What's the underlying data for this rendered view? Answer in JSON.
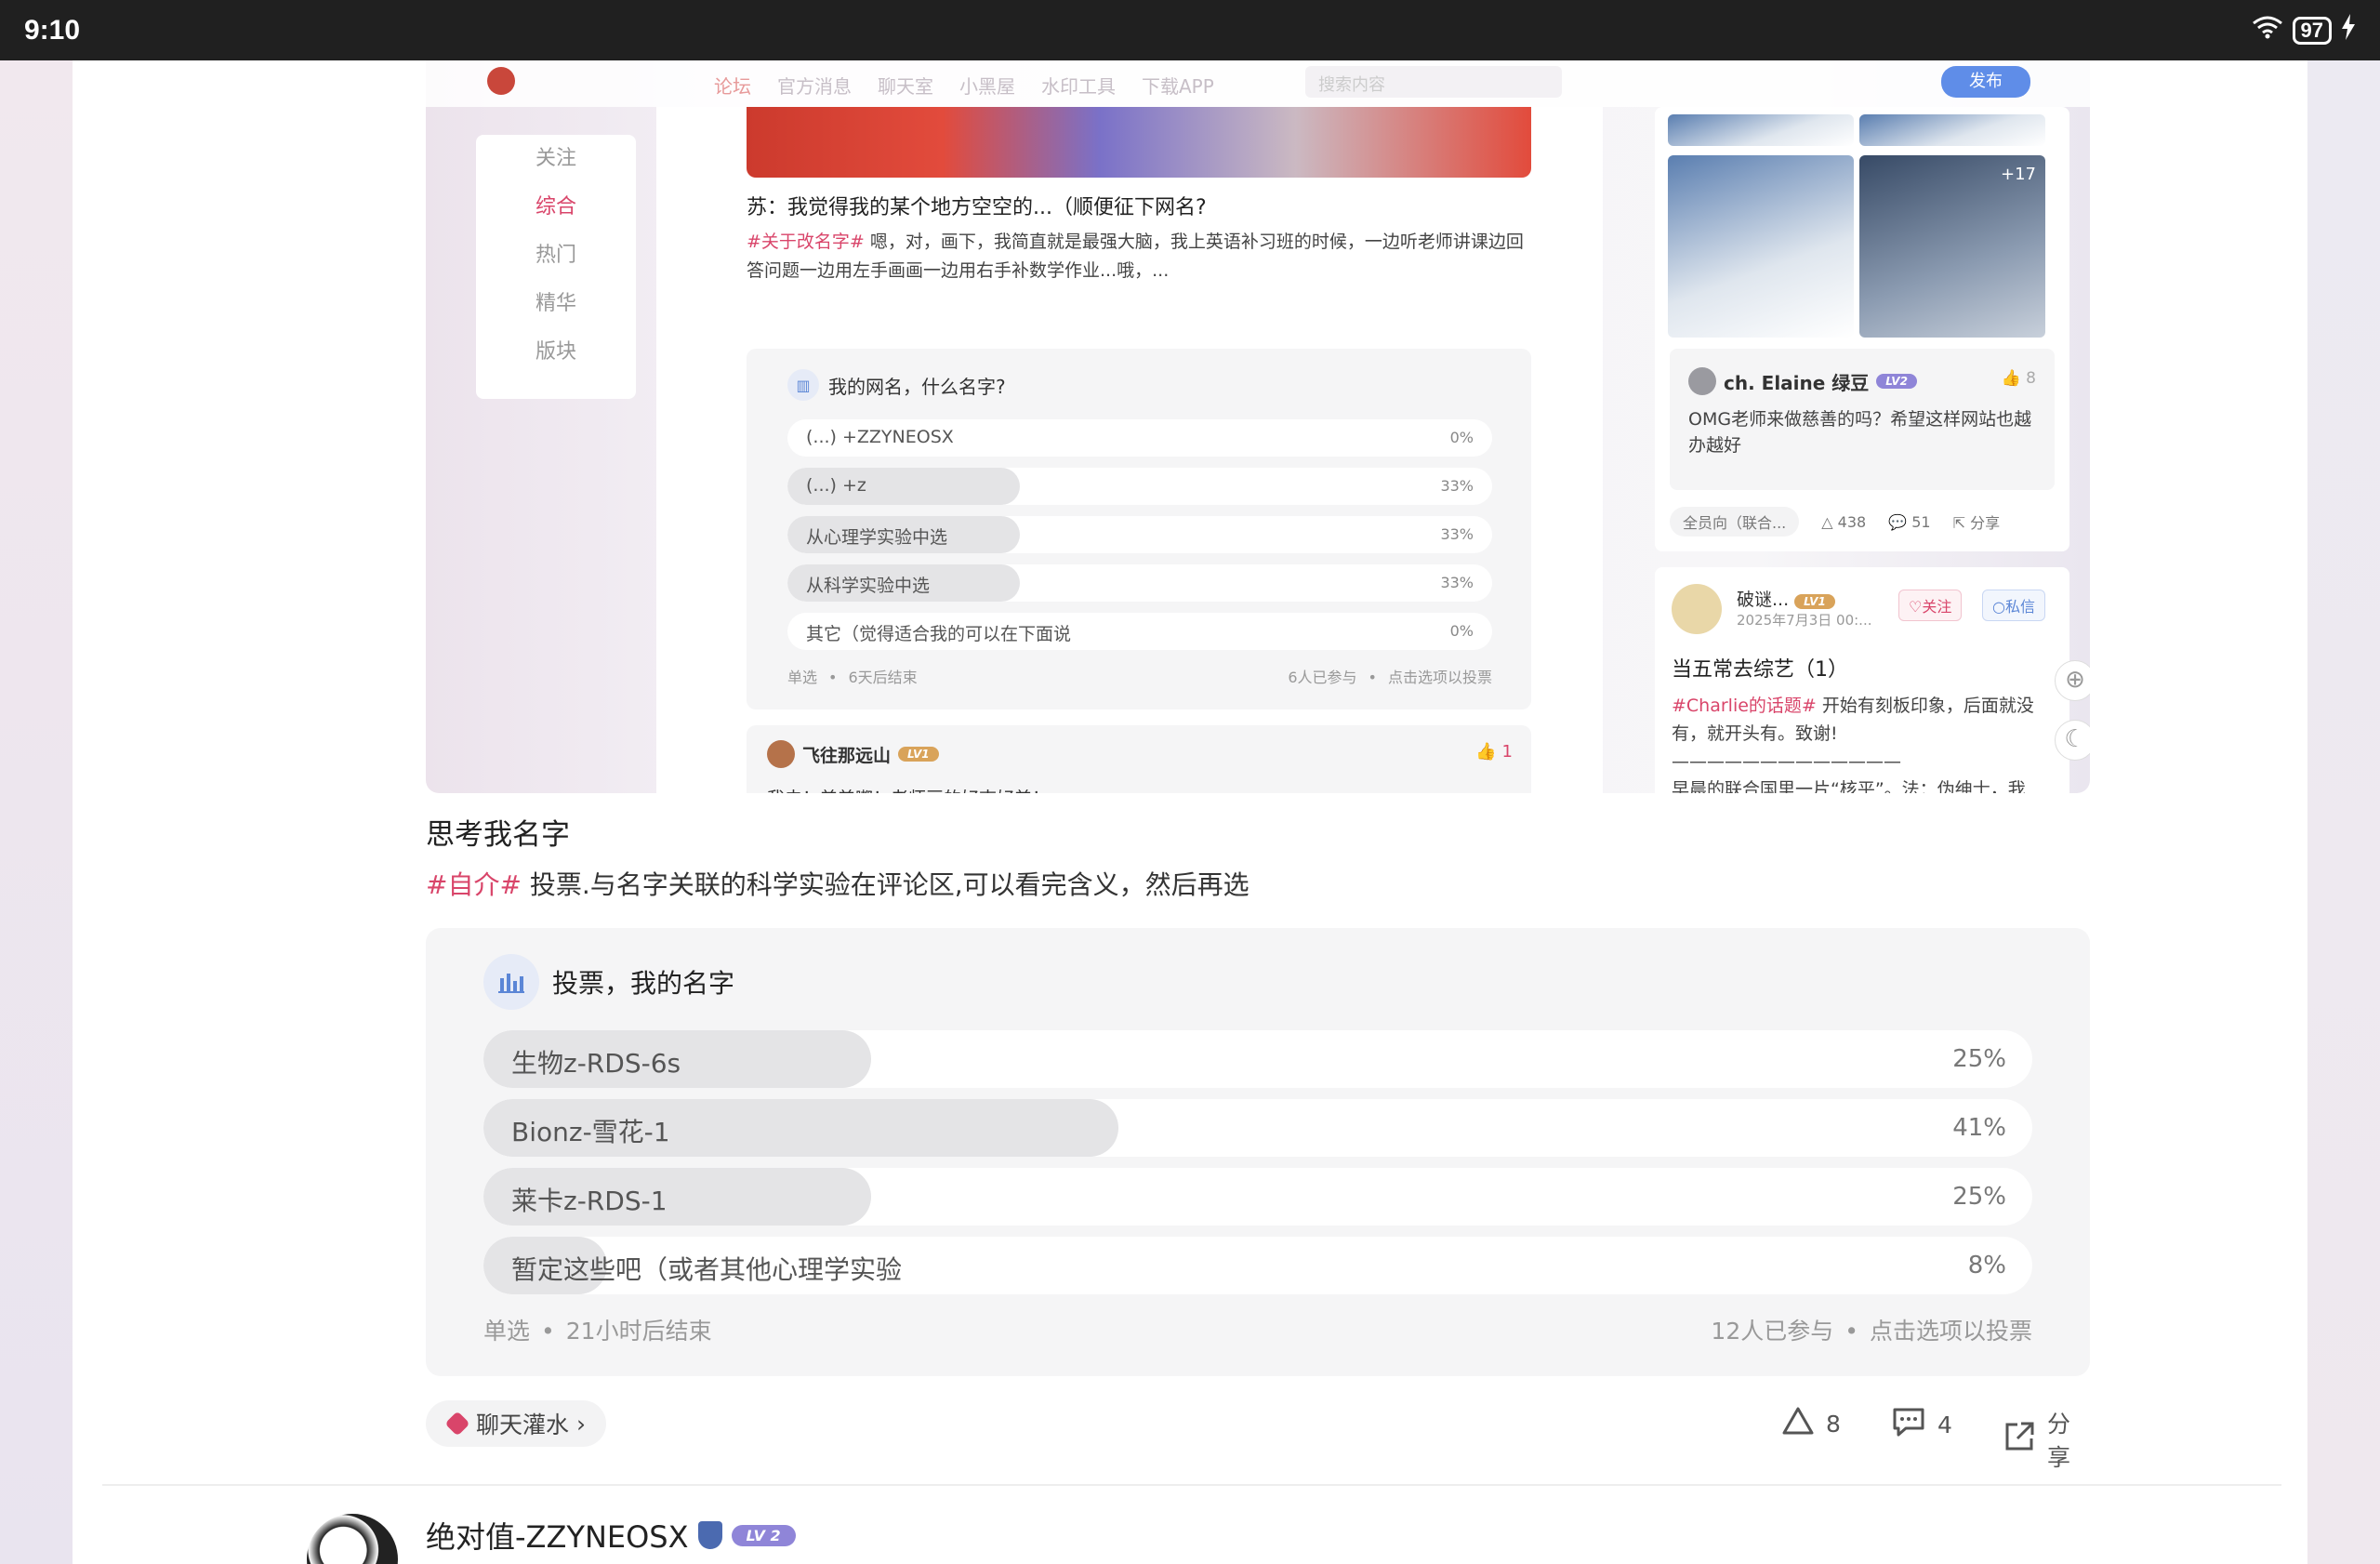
{
  "status_bar": {
    "time": "9:10",
    "battery": "97"
  },
  "embed": {
    "nav": [
      "论坛",
      "官方消息",
      "聊天室",
      "小黑屋",
      "水印工具",
      "下载APP"
    ],
    "search_placeholder": "搜索内容",
    "post_button": "发布",
    "left_menu": [
      "关注",
      "综合",
      "热门",
      "精华",
      "版块"
    ],
    "post": {
      "title": "苏：我觉得我的某个地方空空的...（顺便征下网名?",
      "tag": "#关于改名字#",
      "body": "嗯，对，画下，我简直就是最强大脑，我上英语补习班的时候，一边听老师讲课边回答问题一边用左手画画一边用右手补数学作业...哦，...",
      "vote_title": "我的网名，什么名字?",
      "options": [
        {
          "label": "(...) +ZZYNEOSX",
          "pct": "0%",
          "value": 0
        },
        {
          "label": "(...) +z",
          "pct": "33%",
          "value": 33
        },
        {
          "label": "从心理学实验中选",
          "pct": "33%",
          "value": 33
        },
        {
          "label": "从科学实验中选",
          "pct": "33%",
          "value": 33
        },
        {
          "label": "其它（觉得适合我的可以在下面说",
          "pct": "0%",
          "value": 0
        }
      ],
      "vote_type": "单选",
      "vote_end": "6天后结束",
      "vote_participants": "6人已参与",
      "vote_hint": "点击选项以投票"
    },
    "comment": {
      "user": "飞往那远山",
      "level": "LV1",
      "text": "我去！美美嘟！老师画的好爽好美！",
      "likes": "1"
    },
    "right": {
      "thumb_count": "+17",
      "user": "ch. Elaine 绿豆",
      "level": "LV2",
      "likes": "8",
      "text": "OMG老师来做慈善的吗？希望这样网站也越办越好",
      "category": "全员向（联合...",
      "upvotes": "438",
      "comments": "51",
      "share": "分享"
    },
    "right2": {
      "user": "破谜...",
      "level": "LV1",
      "date": "2025年7月3日 00:...",
      "follow": "关注",
      "dm": "私信",
      "title": "当五常去综艺（1）",
      "tag": "#Charlie的话题#",
      "body": "开始有刻板印象，后面就没有，就开头有。致谢!",
      "body2": "早晨的联合国里一片“核平”。法：伪绅士，我"
    }
  },
  "post": {
    "title": "思考我名字",
    "tag": "#自介#",
    "body": "投票.与名字关联的科学实验在评论区,可以看完含义，然后再选",
    "vote": {
      "title": "投票，我的名字",
      "options": [
        {
          "label": "生物z-RDS-6s",
          "pct": "25%",
          "value": 25
        },
        {
          "label": "Bionz-雪花-1",
          "pct": "41%",
          "value": 41
        },
        {
          "label": "莱卡z-RDS-1",
          "pct": "25%",
          "value": 25
        },
        {
          "label": "暂定这些吧（或者其他心理学实验",
          "pct": "8%",
          "value": 8
        }
      ],
      "type": "单选",
      "end": "21小时后结束",
      "participants": "12人已参与",
      "hint": "点击选项以投票"
    },
    "category": "聊天灌水",
    "upvotes": "8",
    "comments": "4",
    "share": "分享"
  },
  "next_post": {
    "user": "绝对值-ZZYNEOSX",
    "level": "LV 2"
  },
  "colors": {
    "accent": "#d9456a",
    "vote_fill": "#e4e4e6",
    "link": "#5b86d6"
  }
}
